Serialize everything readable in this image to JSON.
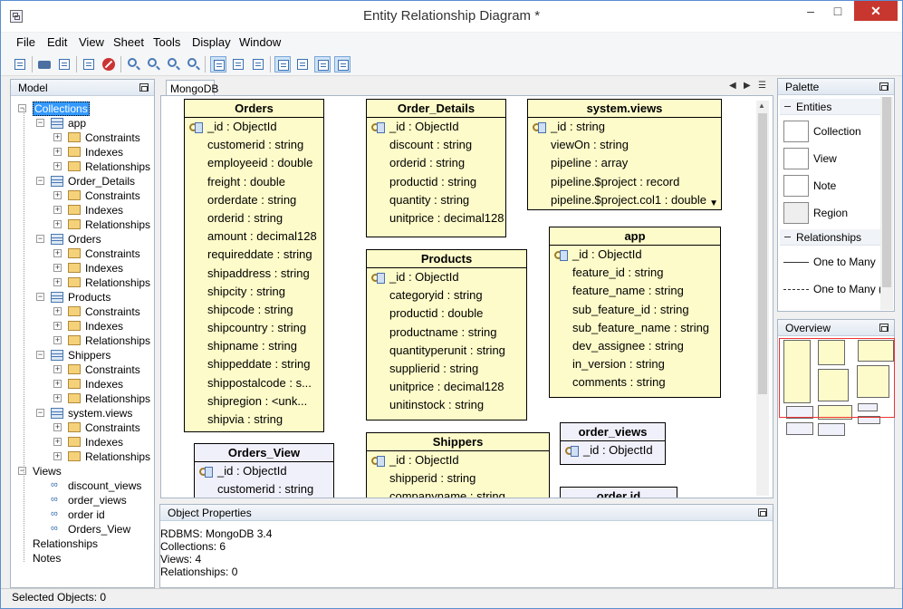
{
  "window": {
    "title": "Entity Relationship Diagram *",
    "minimize": "–",
    "maximize": "□",
    "close": "✕"
  },
  "menu": [
    "File",
    "Edit",
    "View",
    "Sheet",
    "Tools",
    "Display",
    "Window"
  ],
  "model_panel": {
    "title": "Model",
    "root": "Collections",
    "collections": [
      "app",
      "Order_Details",
      "Orders",
      "Products",
      "Shippers",
      "system.views"
    ],
    "folders": [
      "Constraints",
      "Indexes",
      "Relationships"
    ],
    "views_label": "Views",
    "views": [
      "discount_views",
      "order_views",
      "order id",
      "Orders_View"
    ],
    "relationships_label": "Relationships",
    "notes_label": "Notes"
  },
  "canvas": {
    "tab": "MongoDB",
    "entities": {
      "orders": {
        "title": "Orders",
        "fields": [
          "_id : ObjectId",
          "customerid : string",
          "employeeid : double",
          "freight : double",
          "orderdate : string",
          "orderid : string",
          "amount : decimal128",
          "requireddate : string",
          "shipaddress : string",
          "shipcity : string",
          "shipcode : string",
          "shipcountry : string",
          "shipname : string",
          "shippeddate : string",
          "shippostalcode : s...",
          "shipregion : <unk...",
          "shipvia : string"
        ]
      },
      "order_details": {
        "title": "Order_Details",
        "fields": [
          "_id : ObjectId",
          "discount : string",
          "orderid : string",
          "productid : string",
          "quantity : string",
          "unitprice : decimal128"
        ]
      },
      "system_views": {
        "title": "system.views",
        "fields": [
          "_id : string",
          "viewOn : string",
          "pipeline : array",
          "pipeline.$project : record",
          "pipeline.$project.col1 : double"
        ],
        "more": "▼"
      },
      "products": {
        "title": "Products",
        "fields": [
          "_id : ObjectId",
          "categoryid : string",
          "productid : double",
          "productname : string",
          "quantityperunit : string",
          "supplierid : string",
          "unitprice : decimal128",
          "unitinstock : string"
        ]
      },
      "app": {
        "title": "app",
        "fields": [
          "_id : ObjectId",
          "feature_id : string",
          "feature_name : string",
          "sub_feature_id : string",
          "sub_feature_name : string",
          "dev_assignee : string",
          "in_version : string",
          "comments : string"
        ]
      },
      "orders_view": {
        "title": "Orders_View",
        "fields": [
          "_id : ObjectId",
          "customerid : string"
        ]
      },
      "shippers": {
        "title": "Shippers",
        "fields": [
          "_id : ObjectId",
          "shipperid : string",
          "companyname : string"
        ]
      },
      "order_views": {
        "title": "order_views",
        "fields": [
          "_id : ObjectId"
        ]
      },
      "order_id": {
        "title": "order id",
        "fields": []
      }
    }
  },
  "properties": {
    "title": "Object Properties",
    "lines": [
      "RDBMS: MongoDB 3.4",
      "Collections: 6",
      "Views: 4",
      "Relationships: 0"
    ]
  },
  "palette": {
    "title": "Palette",
    "entities_group": "Entities",
    "entities": [
      "Collection",
      "View",
      "Note",
      "Region"
    ],
    "relationships_group": "Relationships",
    "relationships": [
      "One to Many",
      "One to Many (N"
    ]
  },
  "overview": {
    "title": "Overview"
  },
  "status": {
    "text": "Selected Objects: 0"
  },
  "colors": {
    "entity_fill": "#fdfbc9",
    "view_fill": "#f0f0fb",
    "selection": "#3399ff",
    "close": "#c7372f"
  }
}
